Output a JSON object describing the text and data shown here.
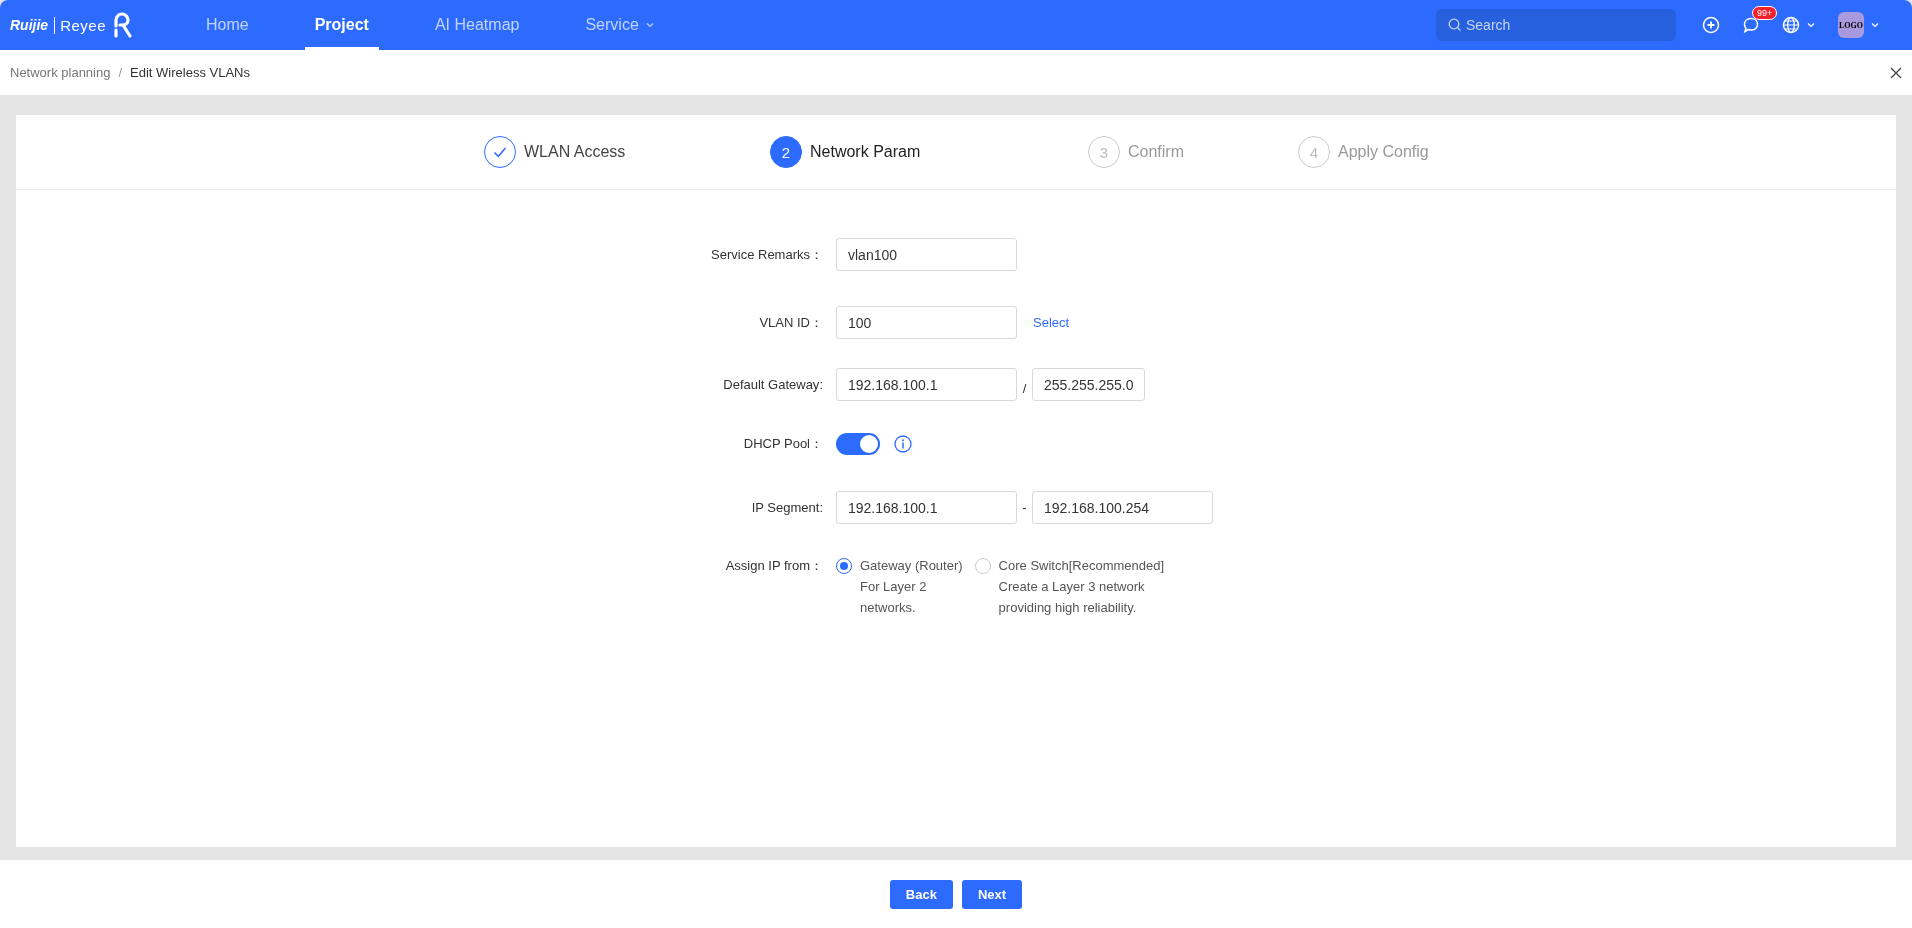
{
  "header": {
    "logo": {
      "brand": "Ruijie",
      "product": "Reyee"
    },
    "nav": [
      {
        "label": "Home",
        "selected": false,
        "dropdown": false
      },
      {
        "label": "Project",
        "selected": true,
        "dropdown": false
      },
      {
        "label": "AI Heatmap",
        "selected": false,
        "dropdown": false
      },
      {
        "label": "Service",
        "selected": false,
        "dropdown": true
      }
    ],
    "search": {
      "placeholder": "Search"
    },
    "notification_badge": "99+",
    "avatar": "LOGO"
  },
  "breadcrumb": [
    {
      "label": "Network planning",
      "current": false
    },
    {
      "label": "Edit Wireless VLANs",
      "current": true
    }
  ],
  "separator": "/",
  "steps": [
    {
      "label": "WLAN Access",
      "done": true,
      "selected": false
    },
    {
      "label": "Network Param",
      "number": "2",
      "done": false,
      "selected": true
    },
    {
      "label": "Confirm",
      "number": "3",
      "done": false,
      "selected": false
    },
    {
      "label": "Apply Config",
      "number": "4",
      "done": false,
      "selected": false
    }
  ],
  "form": [
    {
      "kind": "text",
      "label": "Service Remarks",
      "colon": "：",
      "value": "vlan100"
    },
    {
      "kind": "link",
      "label": "VLAN ID",
      "colon": "：",
      "value": "100",
      "link": "Select"
    },
    {
      "kind": "pair",
      "label": "Default Gateway",
      "colon": ":",
      "value": "192.168.100.1",
      "joiner": "/",
      "value2": "255.255.255.0"
    },
    {
      "kind": "toggle",
      "label": "DHCP Pool",
      "colon": "：",
      "on": true
    },
    {
      "kind": "pair",
      "label": "IP Segment",
      "colon": ":",
      "value": "192.168.100.1",
      "joiner": "-",
      "value2": "192.168.100.254"
    },
    {
      "kind": "radio",
      "label": "Assign IP from",
      "colon": "：",
      "options": [
        {
          "title": "Gateway (Router)",
          "lines": [
            "For Layer 2",
            "networks."
          ],
          "selected": true
        },
        {
          "title": "Core Switch[Recommended]",
          "lines": [
            "Create a Layer 3 network",
            "providing high reliability."
          ],
          "selected": false
        }
      ]
    }
  ],
  "buttons": [
    "Back",
    "Next"
  ]
}
